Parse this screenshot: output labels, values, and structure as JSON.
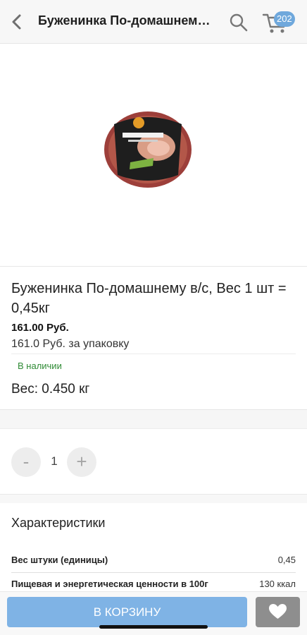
{
  "header": {
    "title": "Буженинка По-домашнем…",
    "back_icon": "chevron-left-icon",
    "search_icon": "search-icon",
    "cart_icon": "cart-icon",
    "cart_count": "202"
  },
  "product": {
    "image_icon": "product-package-image",
    "name": "Буженинка По-домашнему в/с, Вес 1 шт = 0,45кг",
    "price": "161.00 Руб.",
    "unit_price": "161.0 Руб. за упаковку",
    "stock": "В наличии",
    "weight": "Вес: 0.450 кг"
  },
  "quantity": {
    "minus_label": "-",
    "value": "1",
    "plus_label": "+"
  },
  "characteristics": {
    "title": "Характеристики",
    "rows": [
      {
        "key": "Вес штуки (единицы)",
        "value": "0,45"
      },
      {
        "key": "Пищевая и энергетическая ценности в 100г",
        "value": "130 ккал"
      }
    ]
  },
  "actions": {
    "cart_button": "В КОРЗИНУ",
    "favorite_icon": "heart-icon"
  },
  "colors": {
    "accent": "#7fb3e5",
    "stock_green": "#2f8b35",
    "favorite_bg": "#8e8e8e"
  }
}
